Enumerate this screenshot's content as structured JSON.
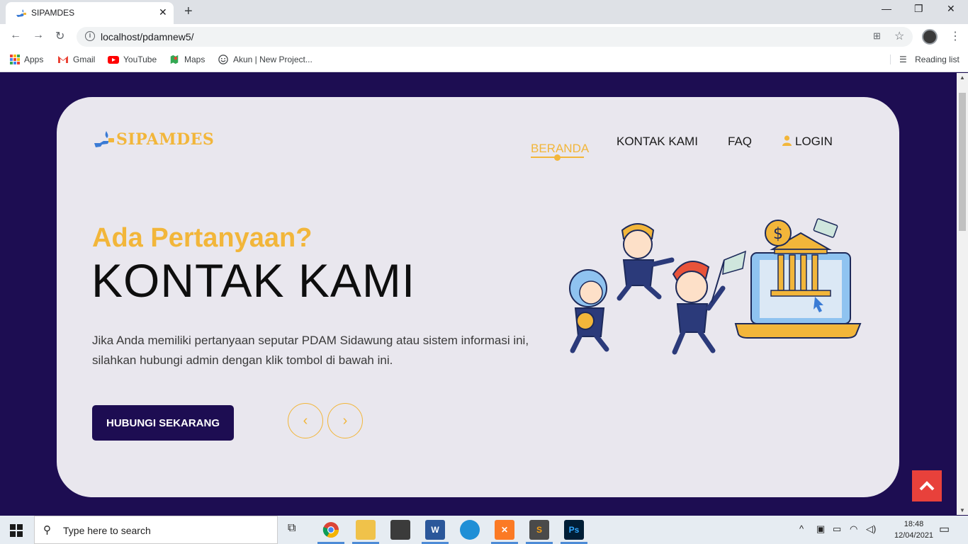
{
  "browser": {
    "tab_title": "SIPAMDES",
    "url": "localhost/pdamnew5/",
    "bookmarks": [
      {
        "label": "Apps",
        "icon": "apps-grid-icon"
      },
      {
        "label": "Gmail",
        "icon": "gmail-icon"
      },
      {
        "label": "YouTube",
        "icon": "youtube-icon"
      },
      {
        "label": "Maps",
        "icon": "maps-icon"
      },
      {
        "label": "Akun | New Project...",
        "icon": "smiley-icon"
      }
    ],
    "reading_list": "Reading list"
  },
  "site": {
    "logo_text": "SIPAMDES",
    "nav": [
      {
        "label": "BERANDA",
        "active": true
      },
      {
        "label": "KONTAK KAMI",
        "active": false
      },
      {
        "label": "FAQ",
        "active": false
      },
      {
        "label": "LOGIN",
        "active": false,
        "icon": "user-icon"
      }
    ],
    "hero": {
      "subtitle": "Ada Pertanyaan?",
      "headline": "KONTAK KAMI",
      "description_line1": "Jika Anda memiliki pertanyaan seputar PDAM Sidawung atau sistem informasi ini,",
      "description_line2": "silahkan hubungi admin dengan klik tombol di bawah ini.",
      "cta_label": "HUBUNGI SEKARANG",
      "prev_icon": "chevron-left-icon",
      "next_icon": "chevron-right-icon"
    }
  },
  "taskbar": {
    "search_placeholder": "Type here to search",
    "time": "18:48",
    "date": "12/04/2021"
  },
  "colors": {
    "accent": "#f2b63a",
    "primary": "#1d0d52",
    "card": "#e9e7ee",
    "scroll_top": "#e8413b"
  }
}
